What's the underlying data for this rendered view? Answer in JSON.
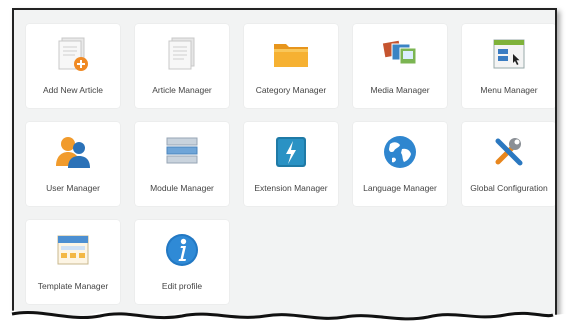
{
  "tiles": [
    {
      "label": "Add New Article",
      "icon": "add-article-icon"
    },
    {
      "label": "Article Manager",
      "icon": "article-manager-icon"
    },
    {
      "label": "Category Manager",
      "icon": "folder-icon"
    },
    {
      "label": "Media Manager",
      "icon": "media-icon"
    },
    {
      "label": "Menu Manager",
      "icon": "menu-icon"
    },
    {
      "label": "User Manager",
      "icon": "users-icon"
    },
    {
      "label": "Module Manager",
      "icon": "module-icon"
    },
    {
      "label": "Extension Manager",
      "icon": "extension-icon"
    },
    {
      "label": "Language Manager",
      "icon": "globe-icon"
    },
    {
      "label": "Global Configuration",
      "icon": "tools-icon"
    },
    {
      "label": "Template Manager",
      "icon": "template-icon"
    },
    {
      "label": "Edit profile",
      "icon": "info-icon"
    }
  ],
  "colors": {
    "panel_background": "#f2f3f3",
    "tile_background": "#ffffff",
    "label_text": "#444444"
  }
}
